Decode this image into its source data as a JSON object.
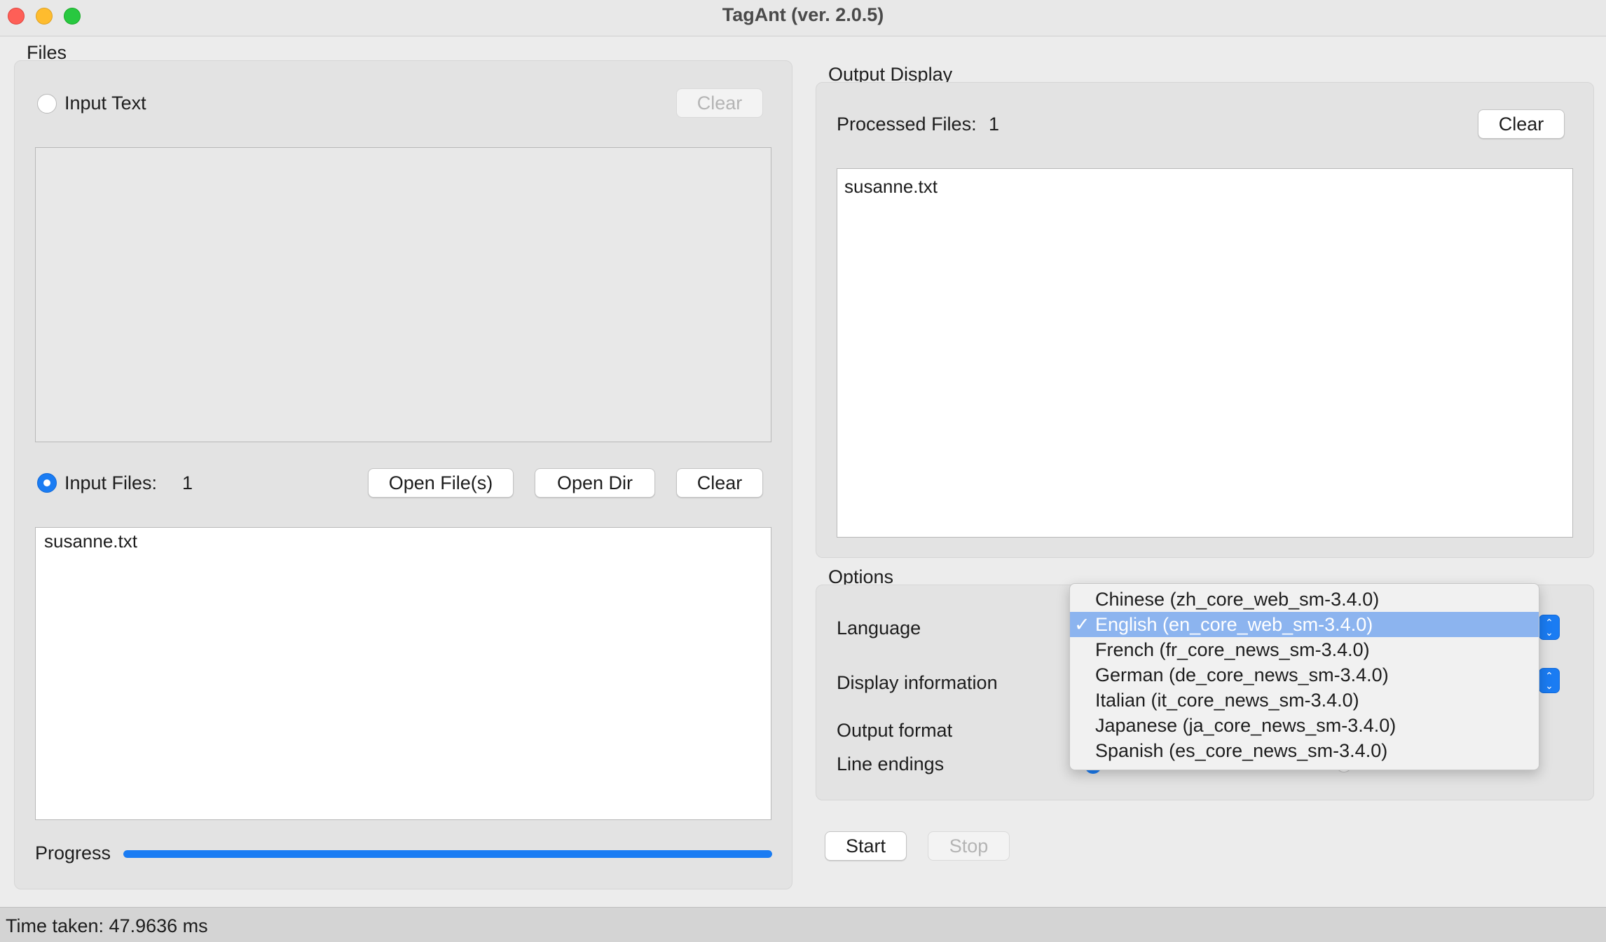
{
  "window": {
    "title": "TagAnt (ver. 2.0.5)"
  },
  "files_panel": {
    "label": "Files",
    "input_text": {
      "label": "Input Text",
      "clear_label": "Clear"
    },
    "input_files": {
      "label": "Input Files:",
      "count": "1",
      "open_files_label": "Open File(s)",
      "open_dir_label": "Open Dir",
      "clear_label": "Clear",
      "files": [
        "susanne.txt"
      ]
    },
    "progress": {
      "label": "Progress",
      "value": 1.0
    }
  },
  "output_panel": {
    "label": "Output Display",
    "processed_label": "Processed Files:",
    "processed_count": "1",
    "clear_label": "Clear",
    "files": [
      "susanne.txt"
    ]
  },
  "options_panel": {
    "label": "Options",
    "language_label": "Language",
    "display_info_label": "Display information",
    "output_format_label": "Output format",
    "line_endings_label": "Line endings",
    "language_dropdown": {
      "check_mark": "✓",
      "selected_index": 1,
      "options": [
        "Chinese (zh_core_web_sm-3.4.0)",
        "English (en_core_web_sm-3.4.0)",
        "French (fr_core_news_sm-3.4.0)",
        "German (de_core_news_sm-3.4.0)",
        "Italian (it_core_news_sm-3.4.0)",
        "Japanese (ja_core_news_sm-3.4.0)",
        "Spanish (es_core_news_sm-3.4.0)"
      ]
    }
  },
  "controls": {
    "start_label": "Start",
    "stop_label": "Stop"
  },
  "status": {
    "text": "Time taken: 47.9636 ms"
  },
  "colors": {
    "accent": "#1a7cf3",
    "selection": "#8cb4ef",
    "close": "#fe5f57",
    "minimize": "#febc2e",
    "maximize": "#28c840"
  }
}
